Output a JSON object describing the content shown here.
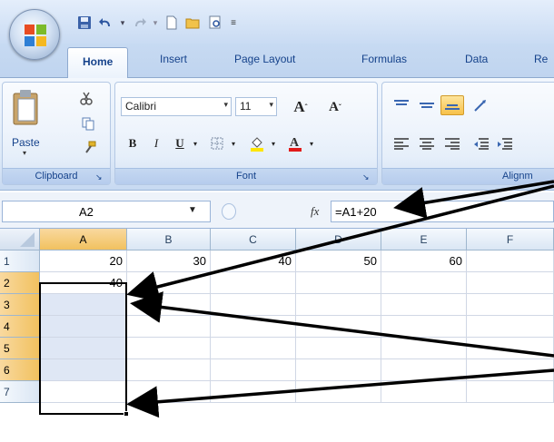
{
  "tabs": [
    "Home",
    "Insert",
    "Page Layout",
    "Formulas",
    "Data",
    "Re"
  ],
  "ribbon": {
    "clipboard": {
      "paste_label": "Paste",
      "group_label": "Clipboard"
    },
    "font": {
      "font_name": "Calibri",
      "font_size": "11",
      "grow_label": "A",
      "shrink_label": "A",
      "bold": "B",
      "italic": "I",
      "underline": "U",
      "group_label": "Font"
    },
    "alignment": {
      "group_label": "Alignm"
    }
  },
  "formula_bar": {
    "name_box": "A2",
    "fx": "fx",
    "formula": "=A1+20"
  },
  "columns": [
    "A",
    "B",
    "C",
    "D",
    "E",
    "F"
  ],
  "rows": [
    "1",
    "2",
    "3",
    "4",
    "5",
    "6",
    "7"
  ],
  "cells": {
    "row1": [
      "20",
      "30",
      "40",
      "50",
      "60",
      ""
    ],
    "row2": [
      "40",
      "",
      "",
      "",
      "",
      ""
    ]
  },
  "colors": {
    "ribbon_text": "#15428b",
    "selected_header": "#f1c15f",
    "selection_fill": "#dfe7f5"
  }
}
